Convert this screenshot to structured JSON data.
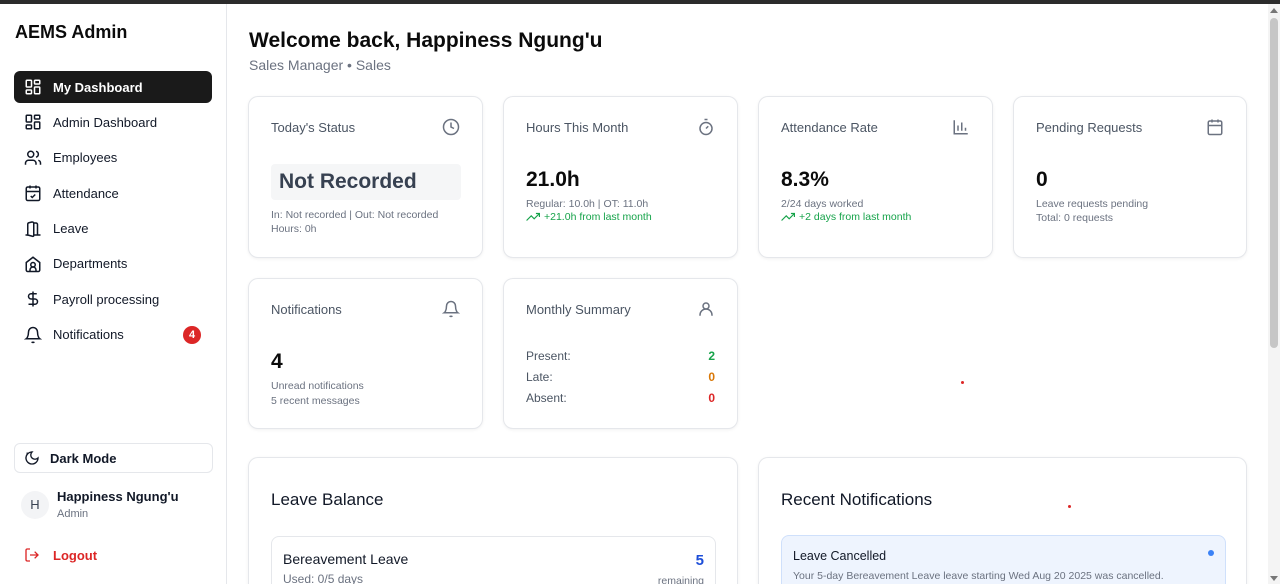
{
  "sidebar": {
    "app_title": "AEMS Admin",
    "items": [
      {
        "label": "My Dashboard",
        "icon": "layout-dashboard-icon",
        "active": true
      },
      {
        "label": "Admin Dashboard",
        "icon": "layout-dashboard-icon"
      },
      {
        "label": "Employees",
        "icon": "users-icon"
      },
      {
        "label": "Attendance",
        "icon": "calendar-check-icon"
      },
      {
        "label": "Leave",
        "icon": "door-open-icon"
      },
      {
        "label": "Departments",
        "icon": "building-icon"
      },
      {
        "label": "Payroll processing",
        "icon": "dollar-icon"
      },
      {
        "label": "Notifications",
        "icon": "bell-icon",
        "badge": "4"
      }
    ],
    "dark_mode_label": "Dark Mode",
    "user": {
      "initial": "H",
      "name": "Happiness Ngung'u",
      "role": "Admin"
    },
    "logout_label": "Logout"
  },
  "header": {
    "welcome": "Welcome back, Happiness Ngung'u",
    "subtitle": "Sales Manager • Sales"
  },
  "cards": {
    "status": {
      "title": "Today's Status",
      "value": "Not Recorded",
      "line1": "In: Not recorded | Out: Not recorded",
      "line2": "Hours: 0h"
    },
    "hours": {
      "title": "Hours This Month",
      "value": "21.0h",
      "line1": "Regular: 10.0h | OT: 11.0h",
      "trend": "+21.0h from last month"
    },
    "attendance": {
      "title": "Attendance Rate",
      "value": "8.3%",
      "line1": "2/24 days worked",
      "trend": "+2 days from last month"
    },
    "pending": {
      "title": "Pending Requests",
      "value": "0",
      "line1": "Leave requests pending",
      "line2": "Total: 0 requests"
    },
    "notifications": {
      "title": "Notifications",
      "value": "4",
      "line1": "Unread notifications",
      "line2": "5 recent messages"
    },
    "summary": {
      "title": "Monthly Summary",
      "present_label": "Present:",
      "present": "2",
      "late_label": "Late:",
      "late": "0",
      "absent_label": "Absent:",
      "absent": "0"
    }
  },
  "leave_balance": {
    "title": "Leave Balance",
    "items": [
      {
        "name": "Bereavement Leave",
        "used": "Used: 0/5 days",
        "count": "5",
        "suffix": "remaining"
      }
    ]
  },
  "recent_notifications": {
    "title": "Recent Notifications",
    "items": [
      {
        "title": "Leave Cancelled",
        "message": "Your 5-day Bereavement Leave leave starting Wed Aug 20 2025 was cancelled."
      }
    ]
  },
  "colors": {
    "accent_dark": "#1a1a1a",
    "danger": "#dc2626",
    "success": "#16a34a",
    "warning": "#d97706",
    "info": "#1d4ed8"
  }
}
